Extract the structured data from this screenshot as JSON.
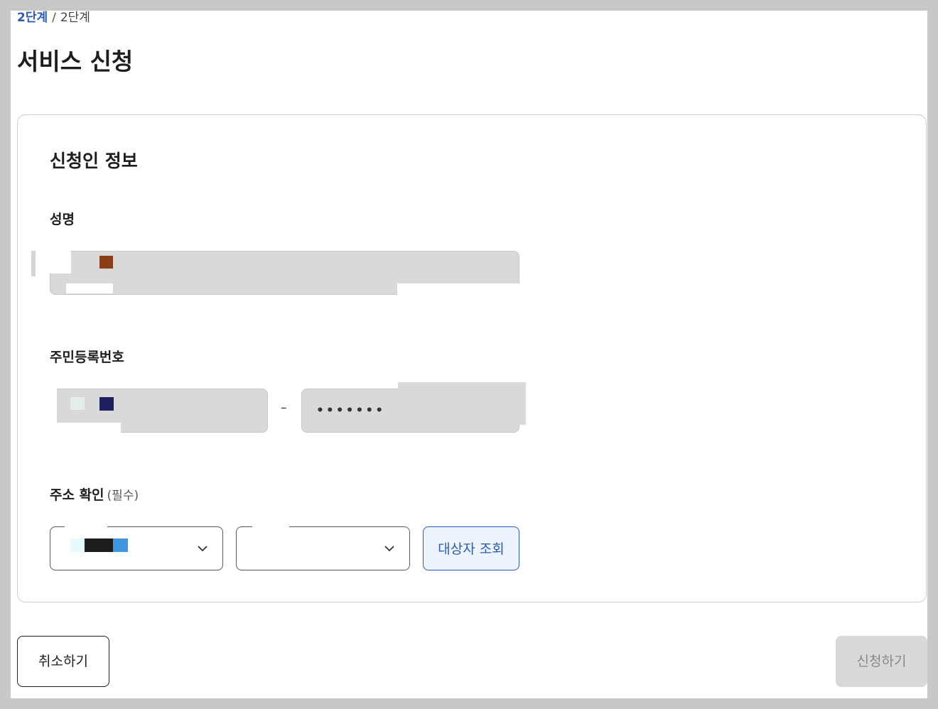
{
  "breadcrumb": {
    "current": "2단계",
    "separator": "/",
    "total": "2단계"
  },
  "page": {
    "title": "서비스 신청"
  },
  "applicant": {
    "section_title": "신청인 정보",
    "name": {
      "label": "성명",
      "value": ""
    },
    "rrn": {
      "label": "주민등록번호",
      "front_value": "",
      "separator": "–",
      "back_value": "•••••••"
    },
    "address": {
      "label": "주소 확인",
      "required_hint": "(필수)",
      "select_1_value": "",
      "select_2_value": "",
      "lookup_button": "대상자 조회"
    }
  },
  "actions": {
    "cancel_label": "취소하기",
    "submit_label": "신청하기"
  },
  "icons": {
    "select_1": "chevron-down-icon",
    "select_2": "chevron-down-icon"
  },
  "colors": {
    "accent": "#2a5bb8",
    "lookup_bg": "#eef4fd",
    "disabled_bg": "#d9d9d9"
  }
}
